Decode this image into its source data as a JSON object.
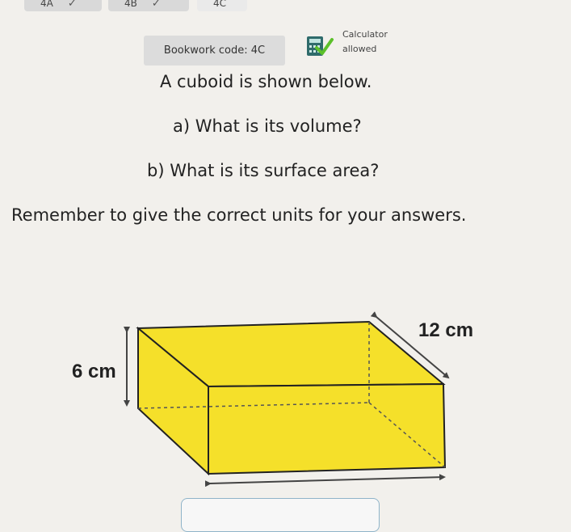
{
  "tabs": [
    {
      "label": "4A",
      "status": "complete"
    },
    {
      "label": "4B",
      "status": "complete"
    },
    {
      "label": "4C",
      "status": "active"
    }
  ],
  "header": {
    "bookwork_code": "Bookwork code: 4C",
    "calculator_label": "Calculator",
    "calculator_status": "allowed"
  },
  "question": {
    "intro": "A cuboid is shown below.",
    "part_a": "a) What is its volume?",
    "part_b": "b) What is its surface area?",
    "reminder": "Remember to give the correct units for your answers."
  },
  "diagram": {
    "height_label": "6 cm",
    "length_label": "12 cm",
    "fill_color": "#f5e02a"
  }
}
